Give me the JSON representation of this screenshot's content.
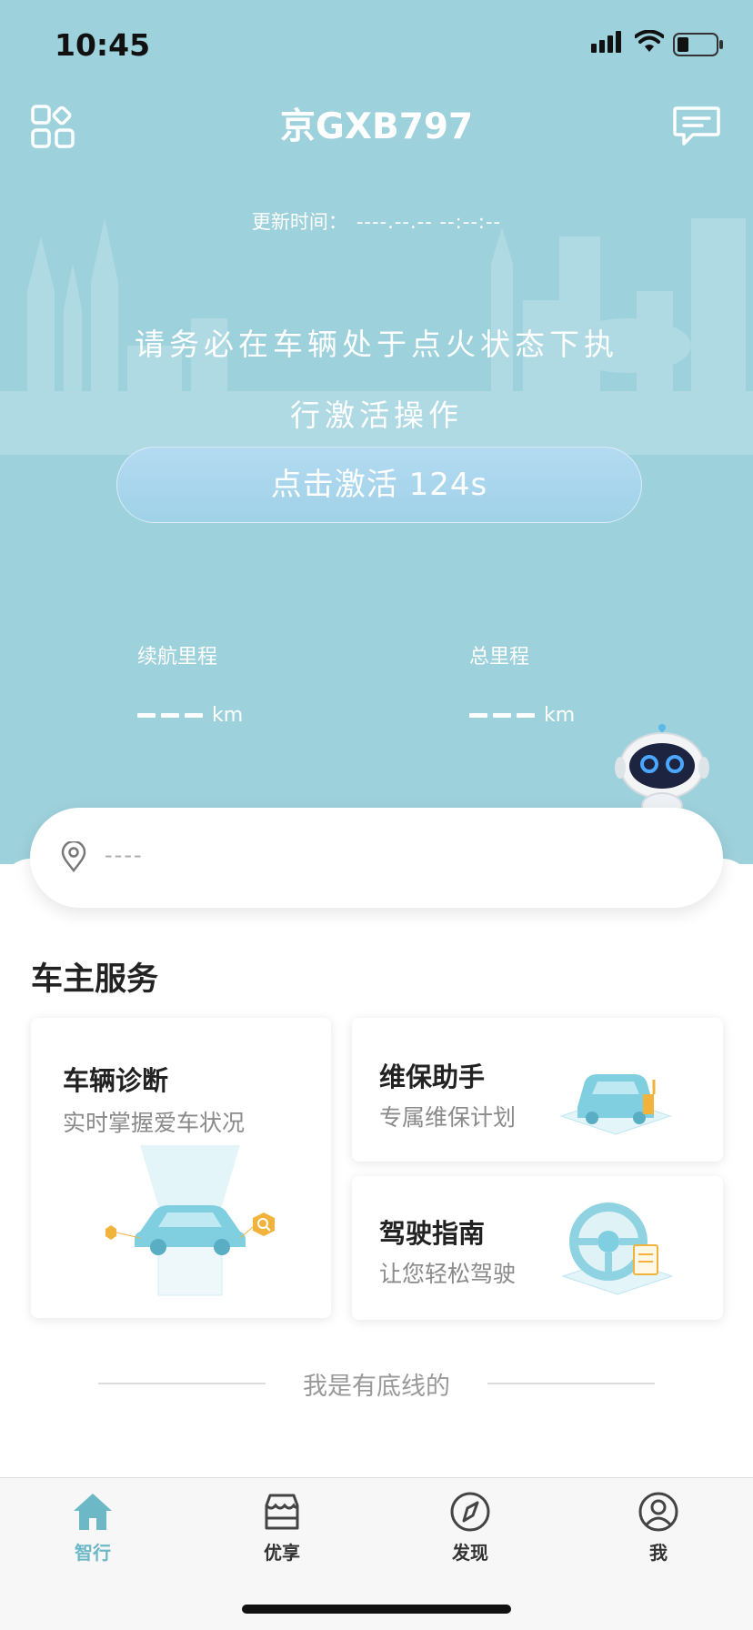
{
  "status_bar": {
    "time": "10:45"
  },
  "header": {
    "title": "京GXB797"
  },
  "update": {
    "label": "更新时间：",
    "value": "----.--.-- --:--:--"
  },
  "notice": {
    "line1": "请务必在车辆处于点火状态下执",
    "line2": "行激活操作"
  },
  "activate_button": {
    "label": "点击激活 124s"
  },
  "stats": {
    "range": {
      "label": "续航里程",
      "unit": "km"
    },
    "total": {
      "label": "总里程",
      "unit": "km"
    }
  },
  "location": {
    "text": "----"
  },
  "services": {
    "title": "车主服务",
    "diagnose": {
      "title": "车辆诊断",
      "subtitle": "实时掌握爱车状况"
    },
    "maintenance": {
      "title": "维保助手",
      "subtitle": "专属维保计划"
    },
    "guide": {
      "title": "驾驶指南",
      "subtitle": "让您轻松驾驶"
    }
  },
  "footer_note": "我是有底线的",
  "tabs": [
    {
      "label": "智行",
      "icon": "home-icon",
      "active": true
    },
    {
      "label": "优享",
      "icon": "store-icon",
      "active": false
    },
    {
      "label": "发现",
      "icon": "compass-icon",
      "active": false
    },
    {
      "label": "我",
      "icon": "user-icon",
      "active": false
    }
  ],
  "colors": {
    "teal": "#9dd1dc",
    "active_tab": "#6cb8c7",
    "accent_orange": "#f2b33d"
  }
}
